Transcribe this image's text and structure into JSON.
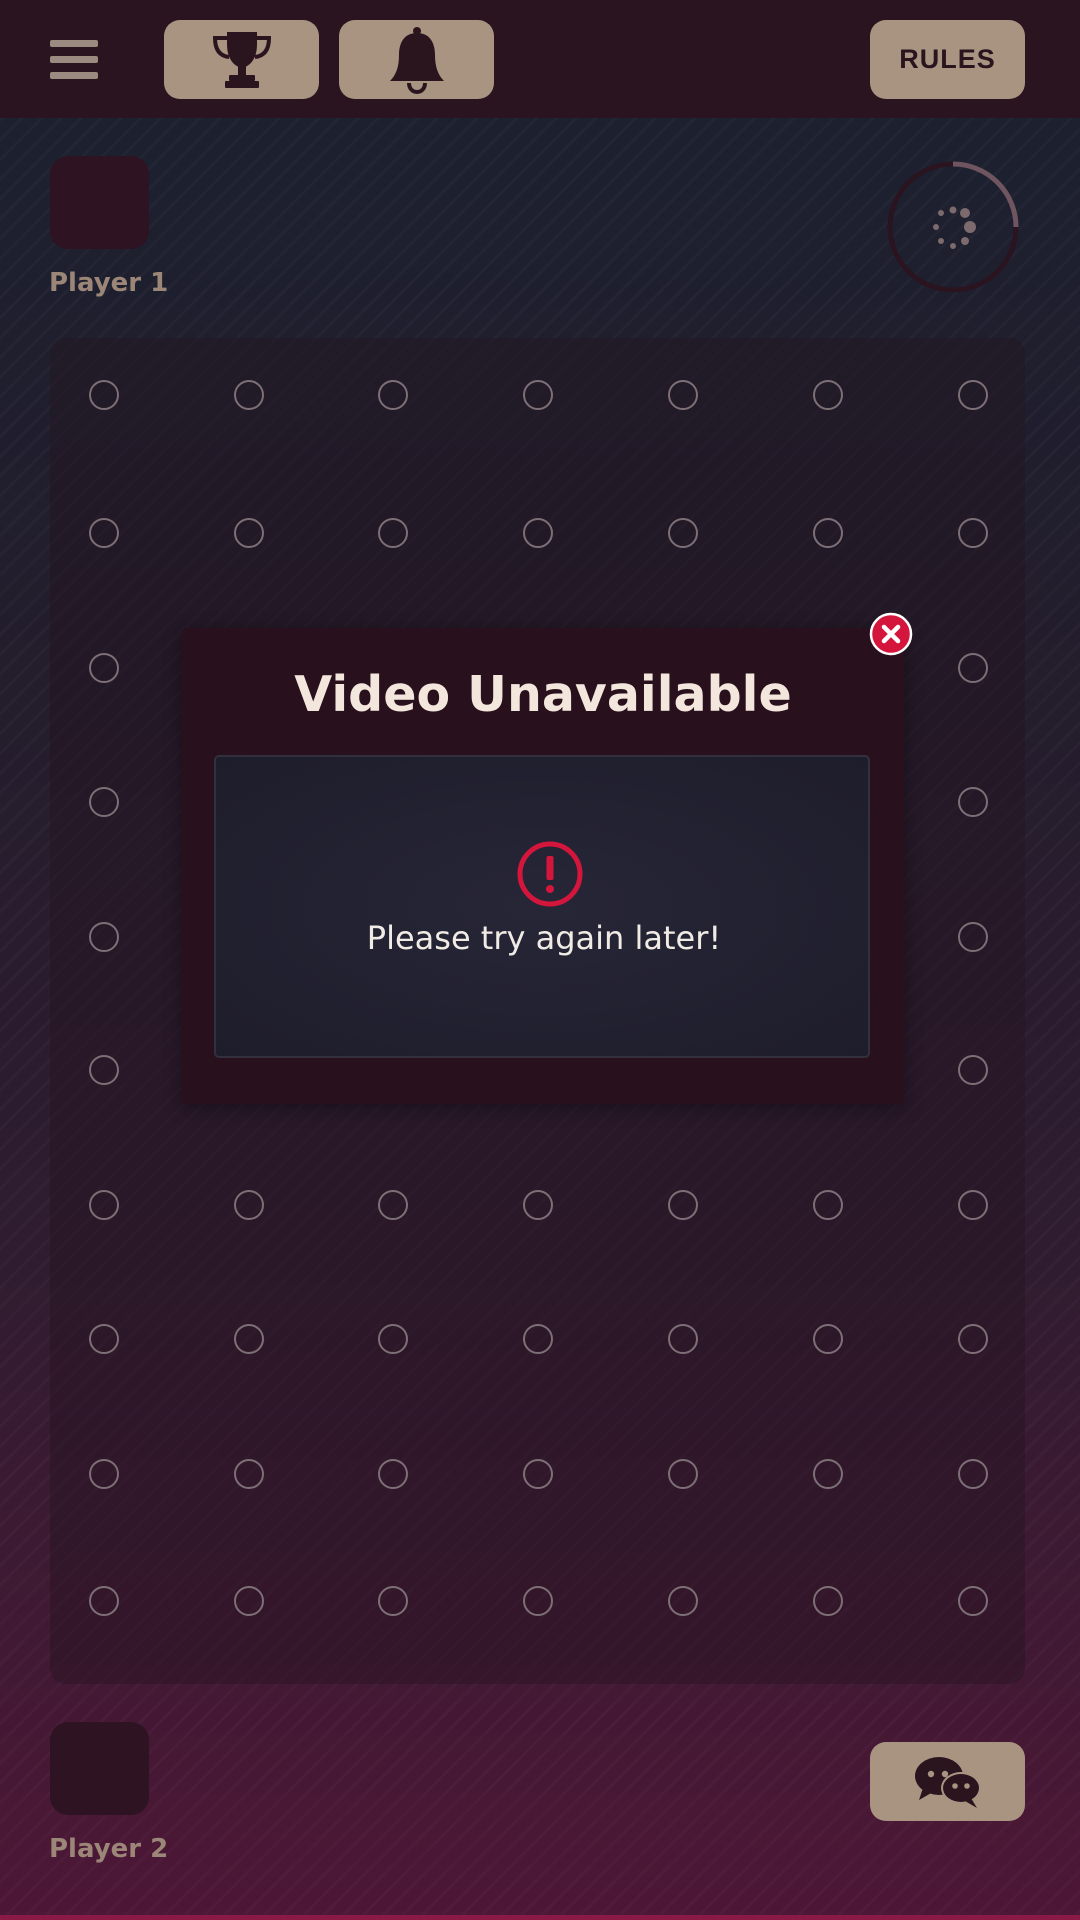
{
  "header": {
    "menu_icon": "hamburger-menu-icon",
    "trophy_icon": "trophy-icon",
    "bell_icon": "bell-icon",
    "rules_label": "RULES"
  },
  "players": {
    "top": {
      "name": "Player 1"
    },
    "bottom": {
      "name": "Player 2"
    }
  },
  "board": {
    "columns": 7,
    "rows": 10
  },
  "modal": {
    "title": "Video Unavailable",
    "error_icon": "exclamation-circle-icon",
    "message": "Please try again later!",
    "close_icon": "close-x-icon"
  },
  "chat_icon": "chat-bubbles-icon",
  "colors": {
    "button_tan": "#a99381",
    "header_bg": "#2a141f",
    "modal_bg": "#29101d",
    "error_red": "#d4163c",
    "title_text": "#f3e7dd"
  }
}
